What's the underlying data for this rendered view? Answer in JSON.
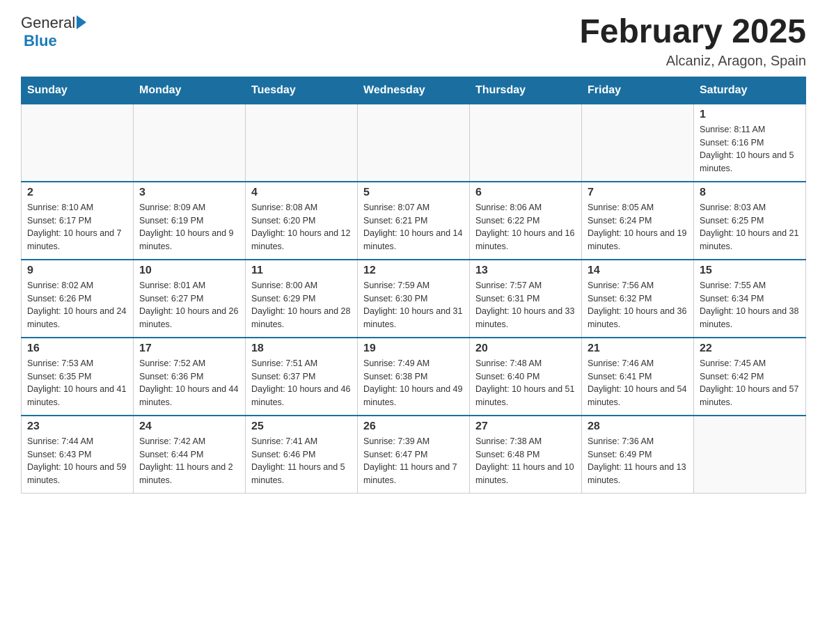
{
  "logo": {
    "general": "General",
    "blue": "Blue"
  },
  "header": {
    "month_title": "February 2025",
    "location": "Alcaniz, Aragon, Spain"
  },
  "weekdays": [
    "Sunday",
    "Monday",
    "Tuesday",
    "Wednesday",
    "Thursday",
    "Friday",
    "Saturday"
  ],
  "weeks": [
    [
      {
        "day": "",
        "info": ""
      },
      {
        "day": "",
        "info": ""
      },
      {
        "day": "",
        "info": ""
      },
      {
        "day": "",
        "info": ""
      },
      {
        "day": "",
        "info": ""
      },
      {
        "day": "",
        "info": ""
      },
      {
        "day": "1",
        "info": "Sunrise: 8:11 AM\nSunset: 6:16 PM\nDaylight: 10 hours and 5 minutes."
      }
    ],
    [
      {
        "day": "2",
        "info": "Sunrise: 8:10 AM\nSunset: 6:17 PM\nDaylight: 10 hours and 7 minutes."
      },
      {
        "day": "3",
        "info": "Sunrise: 8:09 AM\nSunset: 6:19 PM\nDaylight: 10 hours and 9 minutes."
      },
      {
        "day": "4",
        "info": "Sunrise: 8:08 AM\nSunset: 6:20 PM\nDaylight: 10 hours and 12 minutes."
      },
      {
        "day": "5",
        "info": "Sunrise: 8:07 AM\nSunset: 6:21 PM\nDaylight: 10 hours and 14 minutes."
      },
      {
        "day": "6",
        "info": "Sunrise: 8:06 AM\nSunset: 6:22 PM\nDaylight: 10 hours and 16 minutes."
      },
      {
        "day": "7",
        "info": "Sunrise: 8:05 AM\nSunset: 6:24 PM\nDaylight: 10 hours and 19 minutes."
      },
      {
        "day": "8",
        "info": "Sunrise: 8:03 AM\nSunset: 6:25 PM\nDaylight: 10 hours and 21 minutes."
      }
    ],
    [
      {
        "day": "9",
        "info": "Sunrise: 8:02 AM\nSunset: 6:26 PM\nDaylight: 10 hours and 24 minutes."
      },
      {
        "day": "10",
        "info": "Sunrise: 8:01 AM\nSunset: 6:27 PM\nDaylight: 10 hours and 26 minutes."
      },
      {
        "day": "11",
        "info": "Sunrise: 8:00 AM\nSunset: 6:29 PM\nDaylight: 10 hours and 28 minutes."
      },
      {
        "day": "12",
        "info": "Sunrise: 7:59 AM\nSunset: 6:30 PM\nDaylight: 10 hours and 31 minutes."
      },
      {
        "day": "13",
        "info": "Sunrise: 7:57 AM\nSunset: 6:31 PM\nDaylight: 10 hours and 33 minutes."
      },
      {
        "day": "14",
        "info": "Sunrise: 7:56 AM\nSunset: 6:32 PM\nDaylight: 10 hours and 36 minutes."
      },
      {
        "day": "15",
        "info": "Sunrise: 7:55 AM\nSunset: 6:34 PM\nDaylight: 10 hours and 38 minutes."
      }
    ],
    [
      {
        "day": "16",
        "info": "Sunrise: 7:53 AM\nSunset: 6:35 PM\nDaylight: 10 hours and 41 minutes."
      },
      {
        "day": "17",
        "info": "Sunrise: 7:52 AM\nSunset: 6:36 PM\nDaylight: 10 hours and 44 minutes."
      },
      {
        "day": "18",
        "info": "Sunrise: 7:51 AM\nSunset: 6:37 PM\nDaylight: 10 hours and 46 minutes."
      },
      {
        "day": "19",
        "info": "Sunrise: 7:49 AM\nSunset: 6:38 PM\nDaylight: 10 hours and 49 minutes."
      },
      {
        "day": "20",
        "info": "Sunrise: 7:48 AM\nSunset: 6:40 PM\nDaylight: 10 hours and 51 minutes."
      },
      {
        "day": "21",
        "info": "Sunrise: 7:46 AM\nSunset: 6:41 PM\nDaylight: 10 hours and 54 minutes."
      },
      {
        "day": "22",
        "info": "Sunrise: 7:45 AM\nSunset: 6:42 PM\nDaylight: 10 hours and 57 minutes."
      }
    ],
    [
      {
        "day": "23",
        "info": "Sunrise: 7:44 AM\nSunset: 6:43 PM\nDaylight: 10 hours and 59 minutes."
      },
      {
        "day": "24",
        "info": "Sunrise: 7:42 AM\nSunset: 6:44 PM\nDaylight: 11 hours and 2 minutes."
      },
      {
        "day": "25",
        "info": "Sunrise: 7:41 AM\nSunset: 6:46 PM\nDaylight: 11 hours and 5 minutes."
      },
      {
        "day": "26",
        "info": "Sunrise: 7:39 AM\nSunset: 6:47 PM\nDaylight: 11 hours and 7 minutes."
      },
      {
        "day": "27",
        "info": "Sunrise: 7:38 AM\nSunset: 6:48 PM\nDaylight: 11 hours and 10 minutes."
      },
      {
        "day": "28",
        "info": "Sunrise: 7:36 AM\nSunset: 6:49 PM\nDaylight: 11 hours and 13 minutes."
      },
      {
        "day": "",
        "info": ""
      }
    ]
  ]
}
